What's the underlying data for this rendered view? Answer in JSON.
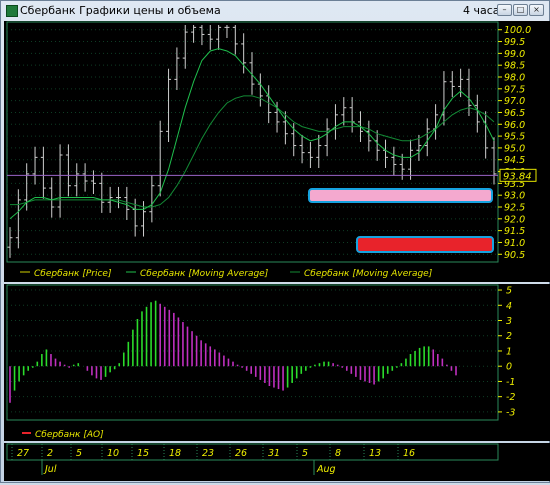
{
  "window": {
    "title": "Сбербанк Графики цены и объема",
    "timeframe": "4 часа"
  },
  "price_chart": {
    "current_price": "93.84",
    "y_ticks": [
      "100.0",
      "99.5",
      "99.0",
      "98.5",
      "98.0",
      "97.5",
      "97.0",
      "96.5",
      "96.0",
      "95.5",
      "95.0",
      "94.5",
      "94.0",
      "93.5",
      "93.0",
      "92.5",
      "92.0",
      "91.5",
      "91.0",
      "90.5"
    ],
    "legend": [
      "Сбербанк [Price]",
      "Сбербанк [Moving Average]",
      "Сбербанк [Moving Average]"
    ],
    "colors": {
      "price": "#cfcfcf",
      "ma_fast": "#1fbf4d",
      "ma_slow": "#138a35",
      "axis": "#f0f000",
      "current_line": "#9a66c8",
      "pink_box": "#f4a9cf",
      "red_box": "#e8232b"
    }
  },
  "ao_chart": {
    "y_ticks": [
      "5",
      "4",
      "3",
      "2",
      "1",
      "0",
      "-1",
      "-2",
      "-3"
    ],
    "legend": [
      "Сбербанк [AO]"
    ],
    "colors": {
      "up": "#2bdc2b",
      "down": "#c030c0"
    }
  },
  "time_axis": {
    "days": [
      "27",
      "2",
      "5",
      "10",
      "15",
      "18",
      "23",
      "26",
      "31",
      "5",
      "8",
      "13",
      "16"
    ],
    "months": [
      "Jul",
      "Aug"
    ]
  },
  "chart_data": [
    {
      "type": "line",
      "ylim": [
        90.3,
        100.2
      ],
      "series": [
        {
          "name": "Сбербанк [Price]",
          "values": [
            91.2,
            92.8,
            93.9,
            94.6,
            93.3,
            92.5,
            94.7,
            93.4,
            93.9,
            93.6,
            93.5,
            92.7,
            92.9,
            92.9,
            92.4,
            91.7,
            92.3,
            93.4,
            95.7,
            97.9,
            98.8,
            99.9,
            100.1,
            99.8,
            99.6,
            100.1,
            100.1,
            99.4,
            98.6,
            97.7,
            97.2,
            96.5,
            96.1,
            95.6,
            95.1,
            94.8,
            94.6,
            95.1,
            95.8,
            96.4,
            96.7,
            96.1,
            95.7,
            95.3,
            94.9,
            94.6,
            94.3,
            94.1,
            94.9,
            95.1,
            95.8,
            96.4,
            97.8,
            97.6,
            97.9,
            96.8,
            96.1,
            95.0,
            93.9
          ]
        },
        {
          "name": "Сбербанк [Moving Average]",
          "values": [
            92.0,
            92.3,
            92.7,
            92.9,
            92.9,
            92.8,
            92.9,
            92.9,
            92.9,
            92.9,
            92.9,
            92.8,
            92.8,
            92.7,
            92.6,
            92.4,
            92.4,
            92.6,
            93.1,
            94.1,
            95.4,
            96.7,
            97.8,
            98.7,
            99.1,
            99.2,
            99.1,
            98.9,
            98.5,
            98.1,
            97.7,
            97.2,
            96.7,
            96.2,
            95.8,
            95.5,
            95.3,
            95.4,
            95.6,
            95.9,
            96.1,
            96.1,
            95.9,
            95.6,
            95.2,
            94.9,
            94.7,
            94.6,
            94.6,
            94.8,
            95.3,
            95.8,
            96.6,
            97.1,
            97.4,
            97.1,
            96.6,
            96.0,
            95.3
          ]
        },
        {
          "name": "Сбербанк [Moving Average]",
          "values": [
            92.6,
            92.6,
            92.7,
            92.8,
            92.8,
            92.8,
            92.8,
            92.8,
            92.8,
            92.8,
            92.8,
            92.8,
            92.8,
            92.8,
            92.7,
            92.6,
            92.5,
            92.5,
            92.6,
            92.9,
            93.4,
            94.0,
            94.7,
            95.4,
            96.0,
            96.5,
            96.9,
            97.1,
            97.2,
            97.2,
            97.1,
            96.9,
            96.7,
            96.4,
            96.1,
            95.9,
            95.8,
            95.7,
            95.7,
            95.8,
            95.9,
            95.9,
            95.9,
            95.8,
            95.6,
            95.5,
            95.4,
            95.3,
            95.3,
            95.4,
            95.6,
            95.8,
            96.1,
            96.4,
            96.6,
            96.7,
            96.6,
            96.4,
            96.1
          ]
        }
      ]
    },
    {
      "type": "bar",
      "ylim": [
        -3.4,
        5.2
      ],
      "series": [
        {
          "name": "Сбербанк [AO]",
          "values": [
            -2.4,
            -1.6,
            -1.0,
            -0.6,
            -0.3,
            -0.1,
            0.3,
            0.8,
            1.1,
            0.8,
            0.5,
            0.3,
            0.1,
            -0.1,
            0.1,
            0.2,
            0.0,
            -0.3,
            -0.6,
            -0.8,
            -0.9,
            -0.7,
            -0.4,
            -0.2,
            0.2,
            0.9,
            1.6,
            2.4,
            3.1,
            3.6,
            3.9,
            4.2,
            4.3,
            4.1,
            3.9,
            3.7,
            3.5,
            3.2,
            2.9,
            2.6,
            2.3,
            2.0,
            1.7,
            1.5,
            1.3,
            1.1,
            0.9,
            0.7,
            0.5,
            0.3,
            0.1,
            -0.1,
            -0.3,
            -0.5,
            -0.7,
            -0.9,
            -1.1,
            -1.3,
            -1.4,
            -1.5,
            -1.6,
            -1.4,
            -1.1,
            -0.8,
            -0.5,
            -0.3,
            -0.1,
            0.1,
            0.2,
            0.3,
            0.3,
            0.2,
            0.1,
            -0.1,
            -0.3,
            -0.5,
            -0.7,
            -0.9,
            -1.0,
            -1.1,
            -1.2,
            -1.0,
            -0.8,
            -0.5,
            -0.3,
            -0.1,
            0.2,
            0.5,
            0.8,
            1.0,
            1.2,
            1.3,
            1.3,
            1.1,
            0.8,
            0.5,
            0.1,
            -0.3,
            -0.6
          ]
        }
      ]
    }
  ]
}
